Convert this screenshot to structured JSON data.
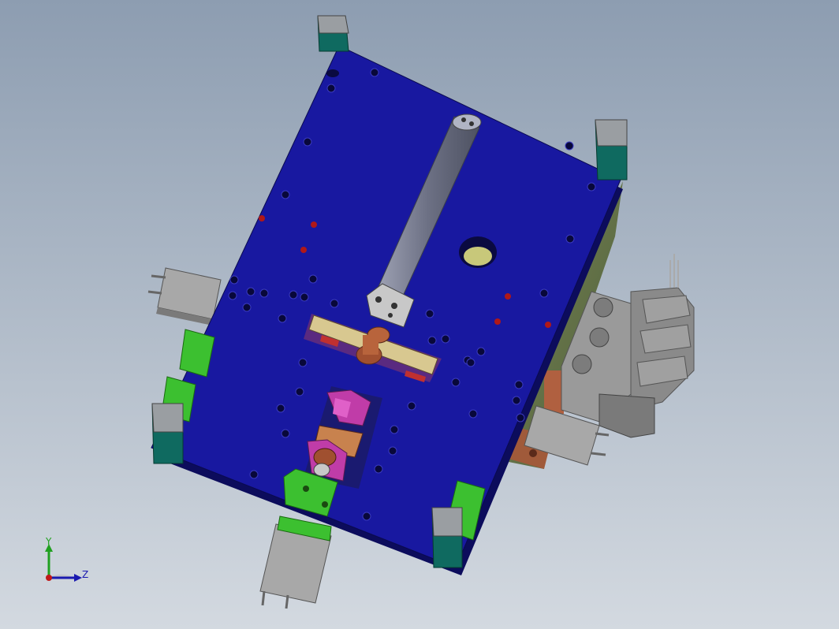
{
  "viewport": {
    "background_top": "#8d9db1",
    "background_bottom": "#d3d9e0"
  },
  "model": {
    "plate_color": "#1818a0",
    "plate_edge_color": "#0c0c5c",
    "post_cap_color": "#9a9ea2",
    "post_body_color": "#0f6a60",
    "rod_color": "#7a7e92",
    "green_part_color": "#3cc030",
    "magenta_part_color": "#c03ca8",
    "copper_part_color": "#b8643c",
    "side_block_color": "#6a7a4a",
    "gray_part_color": "#8c8c8c",
    "marker_red": "#b01818"
  },
  "triad": {
    "y_label": "Y",
    "z_label": "Z",
    "y_color": "#20a020",
    "z_color": "#1a1ab0",
    "origin_color": "#c01818"
  }
}
